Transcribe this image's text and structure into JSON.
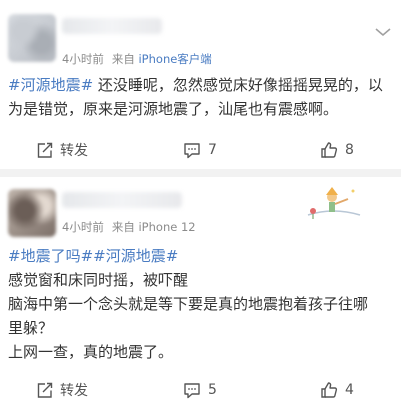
{
  "posts": [
    {
      "time": "4小时前",
      "source_prefix": "来自",
      "source_name": "iPhone客户端",
      "lines": [
        {
          "tag": "#河源地震#",
          "text": " 还没睡呢，忽然感觉床好像摇摇晃晃的，以"
        },
        {
          "tag": "",
          "text": "为是错觉，原来是河源地震了，汕尾也有震感啊。"
        }
      ],
      "repost_label": "转发",
      "comment_count": "7",
      "like_count": "8"
    },
    {
      "time": "4小时前",
      "source_prefix": "来自",
      "source_name": "iPhone 12",
      "lines": [
        {
          "tag": "#地震了吗##河源地震#",
          "text": ""
        },
        {
          "tag": "",
          "text": "感觉窗和床同时摇，被吓醒"
        },
        {
          "tag": "",
          "text": "脑海中第一个念头就是等下要是真的地震抱着孩子往哪"
        },
        {
          "tag": "",
          "text": "里躲？"
        },
        {
          "tag": "",
          "text": "上网一查，真的地震了。"
        }
      ],
      "repost_label": "转发",
      "comment_count": "5",
      "like_count": "4"
    }
  ],
  "colors": {
    "link": "#4a7cc2",
    "meta": "#8b8b8b",
    "text": "#333333",
    "feed_bg": "#f2f2f2"
  },
  "icons": [
    "chevron-down-icon",
    "repost-icon",
    "comment-icon",
    "like-icon"
  ]
}
